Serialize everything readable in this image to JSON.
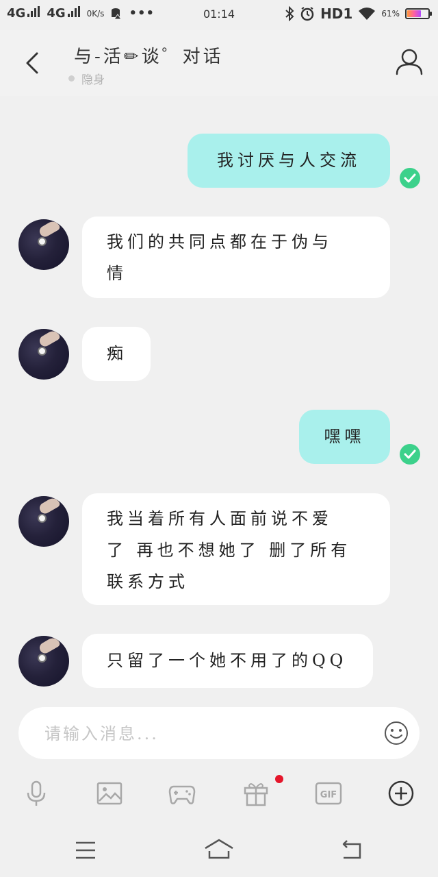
{
  "status_bar": {
    "network1": "4G",
    "network2": "4G",
    "speed": "0K/s",
    "time": "01:14",
    "hd": "HD1",
    "battery_pct": "61%",
    "battery_level": 0.61
  },
  "header": {
    "title": "与-活✏谈゜对话",
    "status": "隐身"
  },
  "messages": [
    {
      "direction": "out",
      "text": "我讨厌与人交流",
      "delivered": true
    },
    {
      "direction": "in",
      "lines": [
        "我们的共同点都在于伪与",
        "情"
      ]
    },
    {
      "direction": "in",
      "text": "痴"
    },
    {
      "direction": "out",
      "text": "嘿嘿",
      "delivered": true
    },
    {
      "direction": "in",
      "lines": [
        "我当着所有人面前说不爱",
        "了 再也不想她了 删了所有",
        "联系方式"
      ]
    },
    {
      "direction": "in",
      "text": "只留了一个她不用了的QQ"
    }
  ],
  "input": {
    "placeholder": "请输入消息..."
  },
  "toolbar": {
    "items": [
      "voice-icon",
      "image-icon",
      "game-icon",
      "gift-icon",
      "gif-icon",
      "plus-icon"
    ],
    "gif_label": "GIF",
    "gift_has_notification": true
  },
  "nav": [
    "menu-icon",
    "home-icon",
    "back-nav-icon"
  ],
  "colors": {
    "background": "#f0f0f0",
    "outgoing_bubble": "#a9f0ec",
    "incoming_bubble": "#ffffff",
    "delivered_check": "#3cd18b",
    "notification_dot": "#e5162b"
  }
}
